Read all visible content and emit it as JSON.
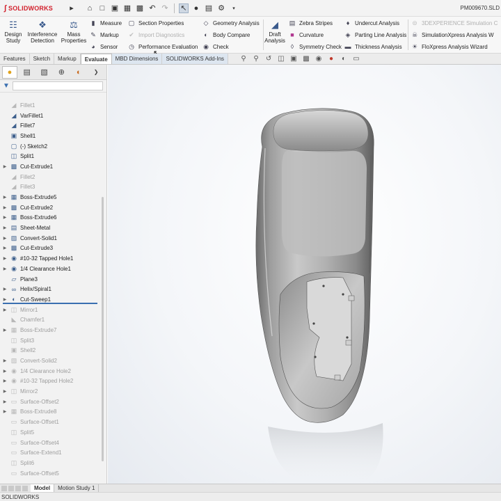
{
  "app": {
    "name": "SOLIDWORKS",
    "document_title": "PM009670.SLD"
  },
  "ribbon": {
    "design_study": "Design\nStudy",
    "interference_detection": "Interference\nDetection",
    "mass_properties": "Mass\nProperties",
    "measure": "Measure",
    "markup": "Markup",
    "sensor": "Sensor",
    "section_properties": "Section Properties",
    "import_diagnostics": "Import Diagnostics",
    "performance_evaluation": "Performance Evaluation",
    "geometry_analysis": "Geometry Analysis",
    "body_compare": "Body Compare",
    "check": "Check",
    "draft_analysis": "Draft\nAnalysis",
    "zebra_stripes": "Zebra Stripes",
    "curvature": "Curvature",
    "symmetry_check": "Symmetry Check",
    "undercut_analysis": "Undercut Analysis",
    "parting_line_analysis": "Parting Line Analysis",
    "thickness_analysis": "Thickness Analysis",
    "experience_simulation": "3DEXPERIENCE Simulation C",
    "simulationxpress": "SimulationXpress Analysis W",
    "floxpress": "FloXpress Analysis Wizard"
  },
  "command_tabs": [
    "Features",
    "Sketch",
    "Markup",
    "Evaluate",
    "MBD Dimensions",
    "SOLIDWORKS Add-Ins"
  ],
  "tree": [
    {
      "label": "Fillet1",
      "suppressed": true,
      "expandable": false,
      "icon": "fillet-icon"
    },
    {
      "label": "VarFillet1",
      "suppressed": false,
      "expandable": false,
      "icon": "fillet-icon"
    },
    {
      "label": "Fillet7",
      "suppressed": false,
      "expandable": false,
      "icon": "fillet-icon"
    },
    {
      "label": "Shell1",
      "suppressed": false,
      "expandable": false,
      "icon": "shell-icon"
    },
    {
      "label": "(-) Sketch2",
      "suppressed": false,
      "expandable": false,
      "icon": "sketch-icon"
    },
    {
      "label": "Split1",
      "suppressed": false,
      "expandable": false,
      "icon": "split-icon"
    },
    {
      "label": "Cut-Extrude1",
      "suppressed": false,
      "expandable": true,
      "icon": "cut-extrude-icon"
    },
    {
      "label": "Fillet2",
      "suppressed": true,
      "expandable": false,
      "icon": "fillet-icon"
    },
    {
      "label": "Fillet3",
      "suppressed": true,
      "expandable": false,
      "icon": "fillet-icon"
    },
    {
      "label": "Boss-Extrude5",
      "suppressed": false,
      "expandable": true,
      "icon": "boss-extrude-icon"
    },
    {
      "label": "Cut-Extrude2",
      "suppressed": false,
      "expandable": true,
      "icon": "cut-extrude-icon"
    },
    {
      "label": "Boss-Extrude6",
      "suppressed": false,
      "expandable": true,
      "icon": "boss-extrude-icon"
    },
    {
      "label": "Sheet-Metal",
      "suppressed": false,
      "expandable": true,
      "icon": "sheet-metal-icon"
    },
    {
      "label": "Convert-Solid1",
      "suppressed": false,
      "expandable": true,
      "icon": "convert-solid-icon"
    },
    {
      "label": "Cut-Extrude3",
      "suppressed": false,
      "expandable": true,
      "icon": "cut-extrude-icon"
    },
    {
      "label": "#10-32 Tapped Hole1",
      "suppressed": false,
      "expandable": true,
      "icon": "hole-icon"
    },
    {
      "label": "1/4 Clearance Hole1",
      "suppressed": false,
      "expandable": true,
      "icon": "hole-icon"
    },
    {
      "label": "Plane3",
      "suppressed": false,
      "expandable": false,
      "icon": "plane-icon"
    },
    {
      "label": "Helix/Spiral1",
      "suppressed": false,
      "expandable": true,
      "icon": "helix-icon"
    },
    {
      "label": "Cut-Sweep1",
      "suppressed": false,
      "expandable": true,
      "icon": "cut-sweep-icon"
    },
    {
      "label": "Mirror1",
      "suppressed": true,
      "expandable": true,
      "icon": "mirror-icon"
    },
    {
      "label": "Chamfer1",
      "suppressed": true,
      "expandable": false,
      "icon": "chamfer-icon"
    },
    {
      "label": "Boss-Extrude7",
      "suppressed": true,
      "expandable": true,
      "icon": "boss-extrude-icon"
    },
    {
      "label": "Split3",
      "suppressed": true,
      "expandable": false,
      "icon": "split-icon"
    },
    {
      "label": "Shell2",
      "suppressed": true,
      "expandable": false,
      "icon": "shell-icon"
    },
    {
      "label": "Convert-Solid2",
      "suppressed": true,
      "expandable": true,
      "icon": "convert-solid-icon"
    },
    {
      "label": "1/4 Clearance Hole2",
      "suppressed": true,
      "expandable": true,
      "icon": "hole-icon"
    },
    {
      "label": "#10-32 Tapped Hole2",
      "suppressed": true,
      "expandable": true,
      "icon": "hole-icon"
    },
    {
      "label": "Mirror2",
      "suppressed": true,
      "expandable": true,
      "icon": "mirror-icon"
    },
    {
      "label": "Surface-Offset2",
      "suppressed": true,
      "expandable": true,
      "icon": "surface-offset-icon"
    },
    {
      "label": "Boss-Extrude8",
      "suppressed": true,
      "expandable": true,
      "icon": "boss-extrude-icon"
    },
    {
      "label": "Surface-Offset1",
      "suppressed": true,
      "expandable": false,
      "icon": "surface-offset-icon"
    },
    {
      "label": "Split5",
      "suppressed": true,
      "expandable": false,
      "icon": "split-icon"
    },
    {
      "label": "Surface-Offset4",
      "suppressed": true,
      "expandable": false,
      "icon": "surface-offset-icon"
    },
    {
      "label": "Surface-Extend1",
      "suppressed": true,
      "expandable": false,
      "icon": "surface-extend-icon"
    },
    {
      "label": "Split6",
      "suppressed": true,
      "expandable": false,
      "icon": "split-icon"
    },
    {
      "label": "Surface-Offset5",
      "suppressed": true,
      "expandable": false,
      "icon": "surface-offset-icon"
    }
  ],
  "bottom_tabs": [
    "Model",
    "Motion Study 1"
  ],
  "status": {
    "text": "SOLIDWORKS"
  },
  "colors": {
    "brand_red": "#d21f2b",
    "rollback_bar": "#3a6fb0",
    "model_gray": "#9a9a9a"
  }
}
